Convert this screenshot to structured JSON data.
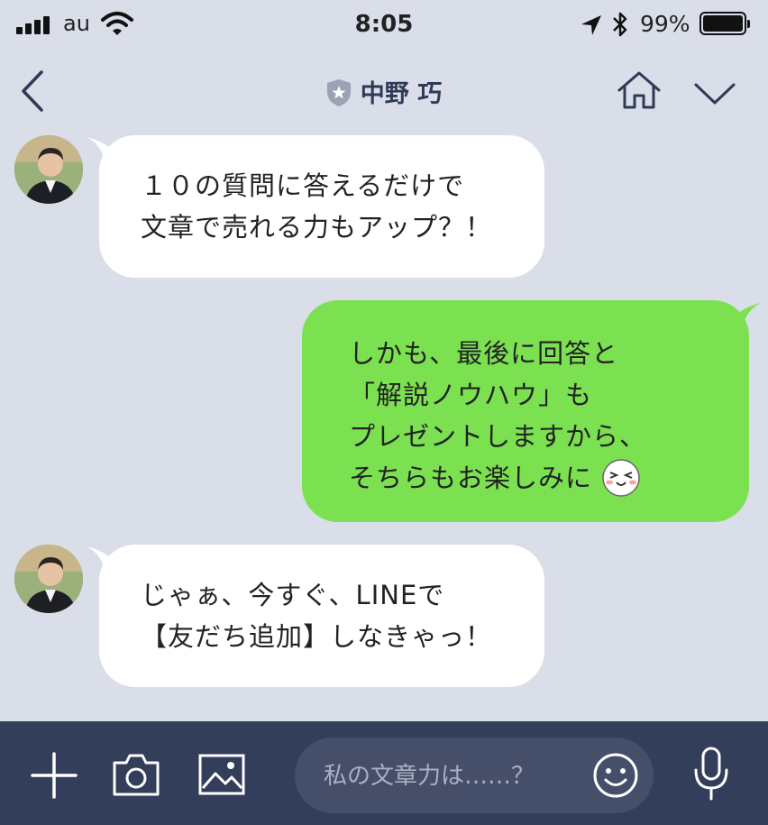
{
  "status_bar": {
    "carrier": "au",
    "time": "8:05",
    "battery_percent": "99%",
    "battery_level": 0.99
  },
  "header": {
    "title": "中野 巧"
  },
  "messages": [
    {
      "direction": "in",
      "lines": [
        "１０の質問に答えるだけで",
        "文章で売れる力もアップ？！"
      ]
    },
    {
      "direction": "out",
      "lines": [
        "しかも、最後に回答と",
        "「解説ノウハウ」も",
        "プレゼントしますから、",
        "そちらもお楽しみに"
      ]
    },
    {
      "direction": "in",
      "lines": [
        "じゃぁ、今すぐ、LINEで",
        "【友だち追加】しなきゃっ！"
      ]
    }
  ],
  "composer": {
    "placeholder": "私の文章力は……？"
  },
  "icons": {
    "back": "chevron-left-icon",
    "home": "home-icon",
    "menu": "chevron-down-icon",
    "plus": "plus-icon",
    "camera": "camera-icon",
    "image": "image-icon",
    "emoji": "smiley-icon",
    "mic": "microphone-icon"
  },
  "colors": {
    "background": "#d9dee9",
    "incoming_bubble": "#ffffff",
    "outgoing_bubble": "#7be151",
    "bottom_bar": "#323e5a",
    "header_text": "#2f3b56"
  }
}
